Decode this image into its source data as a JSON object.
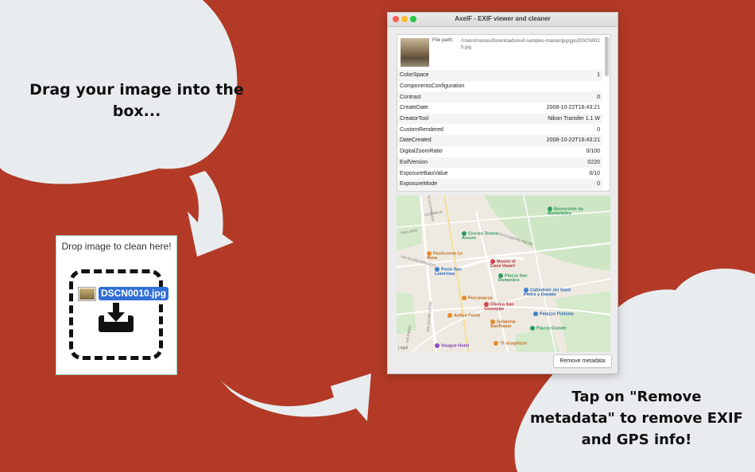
{
  "captions": {
    "left": "Drag your image into the box...",
    "right": "Tap on \"Remove metadata\" to remove EXIF and GPS info!"
  },
  "drop_box": {
    "title": "Drop image to clean here!",
    "filename": "DSCN0010.jpg"
  },
  "window": {
    "title": "AxelF - EXIF viewer and cleaner",
    "file_path_label": "File path:",
    "file_path": "/Users/moises/Downloads/exif-samples-master/jpg/gps/DSCN0025.jpg",
    "exif_rows": [
      {
        "key": "ColorSpace",
        "value": "1"
      },
      {
        "key": "ComponentsConfiguration",
        "value": ""
      },
      {
        "key": "Contrast",
        "value": "0"
      },
      {
        "key": "CreateDate",
        "value": "2008-10-22T16:43:21"
      },
      {
        "key": "CreatorTool",
        "value": "Nikon Transfer 1.1 W"
      },
      {
        "key": "CustomRendered",
        "value": "0"
      },
      {
        "key": "DateCreated",
        "value": "2008-10-22T16:43:21"
      },
      {
        "key": "DigitalZoomRatio",
        "value": "0/100"
      },
      {
        "key": "ExifVersion",
        "value": "0220"
      },
      {
        "key": "ExposureBiasValue",
        "value": "0/10"
      },
      {
        "key": "ExposureMode",
        "value": "0"
      }
    ],
    "remove_button": "Remove metadata"
  },
  "map": {
    "pois": [
      {
        "label": "Buonconte da Montefeltro",
        "color": "#2e9b5b"
      },
      {
        "label": "Circolo Tennis Arezzo",
        "color": "#2e9b5b"
      },
      {
        "label": "Pasticceria Le Mura",
        "color": "#e58a2c"
      },
      {
        "label": "Museo di Casa Vasari",
        "color": "#d1434a"
      },
      {
        "label": "Porta San Lorentino",
        "color": "#3f7fd1"
      },
      {
        "label": "Piazza San Domenico",
        "color": "#2e9b5b"
      },
      {
        "label": "Cattedrale dei Santi Pietro e Donato",
        "color": "#3f7fd1"
      },
      {
        "label": "Porcavacca",
        "color": "#e58a2c"
      },
      {
        "label": "Clinica San Giuseppe",
        "color": "#d1434a"
      },
      {
        "label": "Palazzo Pretorio",
        "color": "#3f7fd1"
      },
      {
        "label": "Antica Fonte",
        "color": "#e58a2c"
      },
      {
        "label": "Gelateria Sunflower",
        "color": "#e58a2c"
      },
      {
        "label": "Piazza Grande",
        "color": "#2e9b5b"
      },
      {
        "label": "Vougue Hotel",
        "color": "#8e4ec6"
      },
      {
        "label": "'O scugnizzo",
        "color": "#e58a2c"
      }
    ],
    "streets": [
      "VIA DELLA CHIMERA",
      "VIA EMILIA",
      "VIA GIUSEPPE PIETRI",
      "VIA LAZIO",
      "VIA LEONE LEONI",
      "VIA GUIDO MONACO",
      "VIA PIERO"
    ],
    "legal": "Legal"
  }
}
